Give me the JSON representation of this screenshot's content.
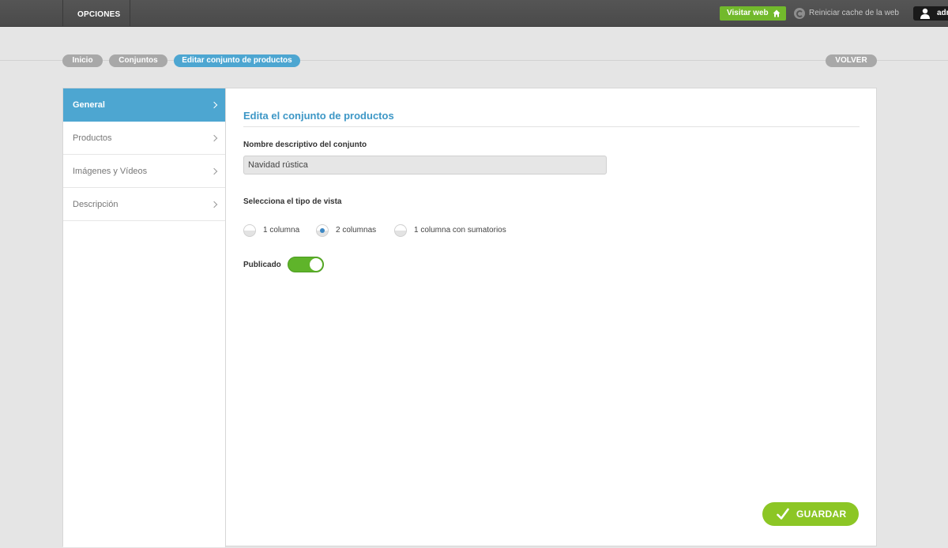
{
  "topbar": {
    "options_label": "OPCIONES",
    "visit_label": "Visitar web",
    "cache_label": "Reiniciar cache de la web",
    "user_label": "admin"
  },
  "breadcrumb": {
    "items": [
      "Inicio",
      "Conjuntos",
      "Editar conjunto de productos"
    ],
    "back_label": "VOLVER"
  },
  "sidebar": {
    "items": [
      {
        "label": "General",
        "active": true
      },
      {
        "label": "Productos"
      },
      {
        "label": "Imágenes y Vídeos"
      },
      {
        "label": "Descripción"
      }
    ]
  },
  "form": {
    "title": "Edita el conjunto de productos",
    "name_label": "Nombre descriptivo del conjunto",
    "name_value": "Navidad rústica",
    "view_label": "Selecciona el tipo de vista",
    "view_options": [
      "1 columna",
      "2 columnas",
      "1 columna con sumatorios"
    ],
    "view_selected": "2 columnas",
    "published_label": "Publicado",
    "published": true,
    "save_label": "GUARDAR"
  },
  "colors": {
    "accent_blue": "#4da6d1",
    "green": "#72b92c",
    "save_green": "#8cc625"
  }
}
